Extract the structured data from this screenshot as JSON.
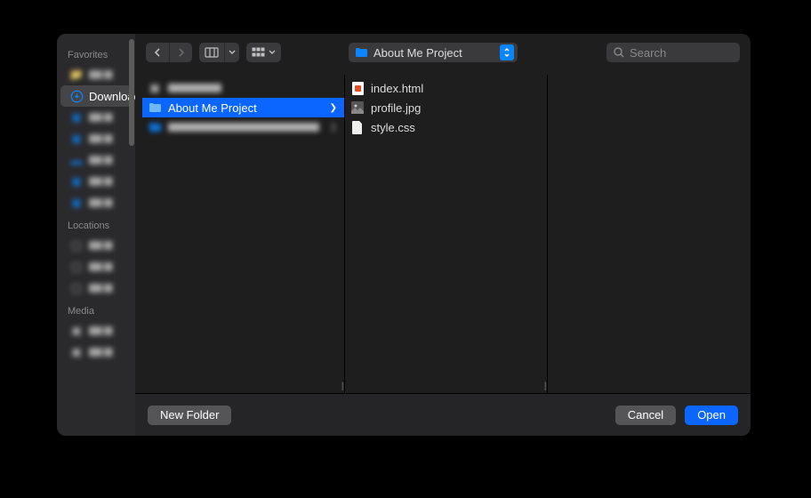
{
  "sidebar": {
    "sections": {
      "favorites": {
        "title": "Favorites",
        "downloads": "Downloads"
      },
      "locations": {
        "title": "Locations"
      },
      "media": {
        "title": "Media"
      }
    }
  },
  "toolbar": {
    "path_label": "About Me Project",
    "search_placeholder": "Search"
  },
  "columns": {
    "col1": {
      "selected": "About Me Project"
    },
    "col2": {
      "files": [
        "index.html",
        "profile.jpg",
        "style.css"
      ]
    }
  },
  "footer": {
    "new_folder": "New Folder",
    "cancel": "Cancel",
    "open": "Open"
  }
}
